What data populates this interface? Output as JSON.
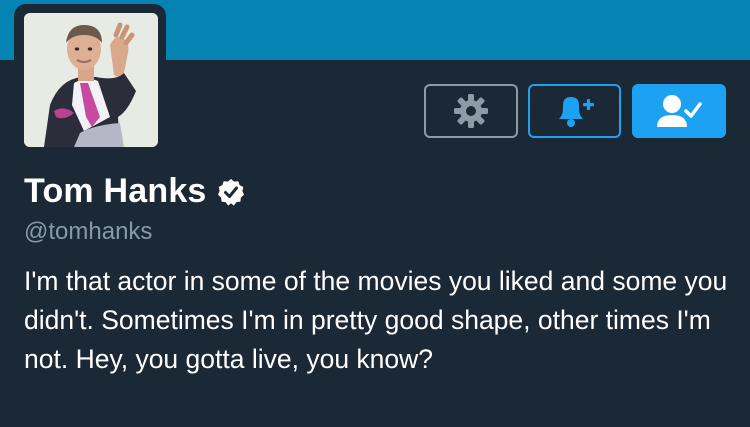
{
  "profile": {
    "display_name": "Tom Hanks",
    "handle": "@tomhanks",
    "verified": true,
    "bio": "I'm that actor in some of the movies you liked and some you didn't. Sometimes I'm in pretty good shape, other times I'm not. Hey, you gotta live, you know?"
  },
  "actions": {
    "settings_icon": "gear-icon",
    "notify_icon": "bell-plus-icon",
    "follow_icon": "person-check-icon"
  },
  "colors": {
    "banner": "#0583b3",
    "background": "#1b2836",
    "accent": "#1da1f2",
    "secondary_text": "#8899a6"
  }
}
